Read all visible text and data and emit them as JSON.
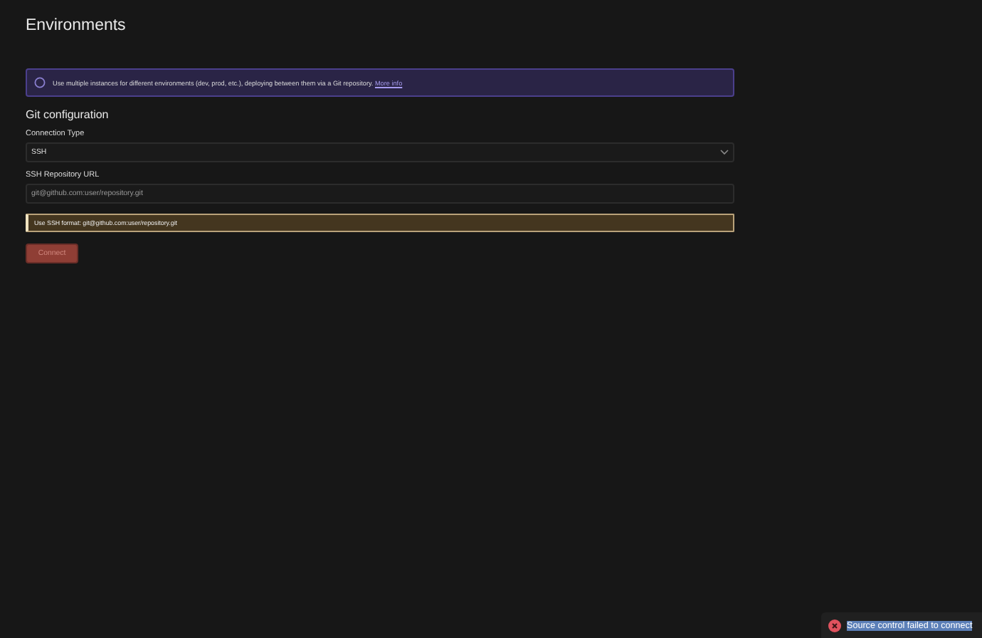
{
  "page_title": "Environments",
  "info_banner": {
    "text": "Use multiple instances for different environments (dev, prod, etc.), deploying between them via a Git repository.",
    "link": "More info"
  },
  "section_title": "Git configuration",
  "connection_type": {
    "label": "Connection Type",
    "value": "SSH"
  },
  "repository_url": {
    "label": "SSH Repository URL",
    "placeholder": "git@github.com:user/repository.git"
  },
  "hint": {
    "text": "Use SSH format: git@github.com:user/repository.git"
  },
  "connect_button": {
    "label": "Connect",
    "disabled": true
  },
  "toast": {
    "kind": "error",
    "text": "Source control failed to connect",
    "text_selected": true
  }
}
